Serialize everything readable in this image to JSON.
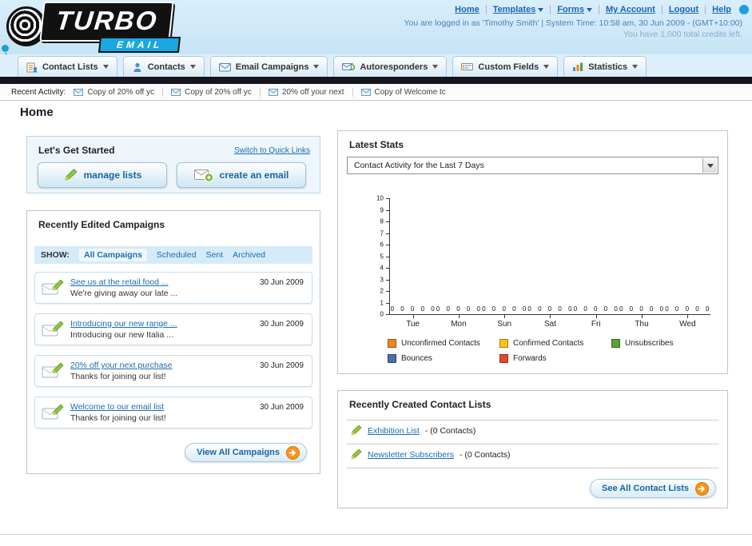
{
  "header": {
    "logo_title": "TURBO",
    "logo_subtitle": "EMAIL",
    "nav": {
      "items": [
        {
          "label": "Home"
        },
        {
          "label": "Templates"
        },
        {
          "label": "Forms"
        },
        {
          "label": "My Account"
        },
        {
          "label": "Logout"
        },
        {
          "label": "Help"
        }
      ]
    },
    "login_info": "You are logged in as 'Timothy Smith' | System Time: 10:58 am, 30 Jun 2009 - (GMT+10:00)",
    "credits": "You have 1,000 total credits left."
  },
  "tabs": {
    "items": [
      {
        "label": "Contact Lists"
      },
      {
        "label": "Contacts"
      },
      {
        "label": "Email Campaigns"
      },
      {
        "label": "Autoresponders"
      },
      {
        "label": "Custom Fields"
      },
      {
        "label": "Statistics"
      }
    ]
  },
  "activity": {
    "label": "Recent Activity:",
    "items": [
      {
        "text": "Copy of 20% off yc"
      },
      {
        "text": "Copy of 20% off yc"
      },
      {
        "text": "20% off your next"
      },
      {
        "text": "Copy of Welcome tc"
      }
    ]
  },
  "page_title": "Home",
  "get_started": {
    "title": "Let's Get Started",
    "switch_link": "Switch to Quick Links",
    "manage_button": "manage lists",
    "create_button": "create an email"
  },
  "campaigns": {
    "title": "Recently Edited Campaigns",
    "show_label": "SHOW:",
    "filters": [
      {
        "label": "All Campaigns",
        "selected": true
      },
      {
        "label": "Scheduled"
      },
      {
        "label": "Sent"
      },
      {
        "label": "Archived"
      }
    ],
    "items": [
      {
        "title": "See us at the retail food ...",
        "subtitle": "We're giving away our late ...",
        "date": "30 Jun 2009"
      },
      {
        "title": "Introducing our new range ...",
        "subtitle": "Introducing our new Italia ...",
        "date": "30 Jun 2009"
      },
      {
        "title": "20% off your next purchase",
        "subtitle": "Thanks for joining our list!",
        "date": "30 Jun 2009"
      },
      {
        "title": "Welcome to our email list",
        "subtitle": "Thanks for joining our list!",
        "date": "30 Jun 2009"
      }
    ],
    "view_all_button": "View All Campaigns"
  },
  "stats": {
    "title": "Latest Stats",
    "dropdown_value": "Contact Activity for the Last 7 Days",
    "chart_data": {
      "type": "bar",
      "title": "Contact Activity for the Last 7 Days",
      "categories": [
        "Tue",
        "Mon",
        "Sun",
        "Sat",
        "Fri",
        "Thu",
        "Wed"
      ],
      "series": [
        {
          "name": "Unconfirmed Contacts",
          "color": "#f5821f",
          "values": [
            0,
            0,
            0,
            0,
            0,
            0,
            0
          ]
        },
        {
          "name": "Confirmed Contacts",
          "color": "#fdc216",
          "values": [
            0,
            0,
            0,
            0,
            0,
            0,
            0
          ]
        },
        {
          "name": "Unsubscribes",
          "color": "#5aa336",
          "values": [
            0,
            0,
            0,
            0,
            0,
            0,
            0
          ]
        },
        {
          "name": "Bounces",
          "color": "#4d6da8",
          "values": [
            0,
            0,
            0,
            0,
            0,
            0,
            0
          ]
        },
        {
          "name": "Forwards",
          "color": "#e2492f",
          "values": [
            0,
            0,
            0,
            0,
            0,
            0,
            0
          ]
        }
      ],
      "ylim": [
        0,
        10
      ],
      "xlabel": "",
      "ylabel": "",
      "grid": false,
      "legend_position": "bottom"
    }
  },
  "contact_lists": {
    "title": "Recently Created Contact Lists",
    "items": [
      {
        "name": "Exhibition List",
        "suffix": "- (0 Contacts)"
      },
      {
        "name": "Newsletter Subscribers",
        "suffix": "- (0 Contacts)"
      }
    ],
    "see_all_button": "See All Contact Lists"
  }
}
